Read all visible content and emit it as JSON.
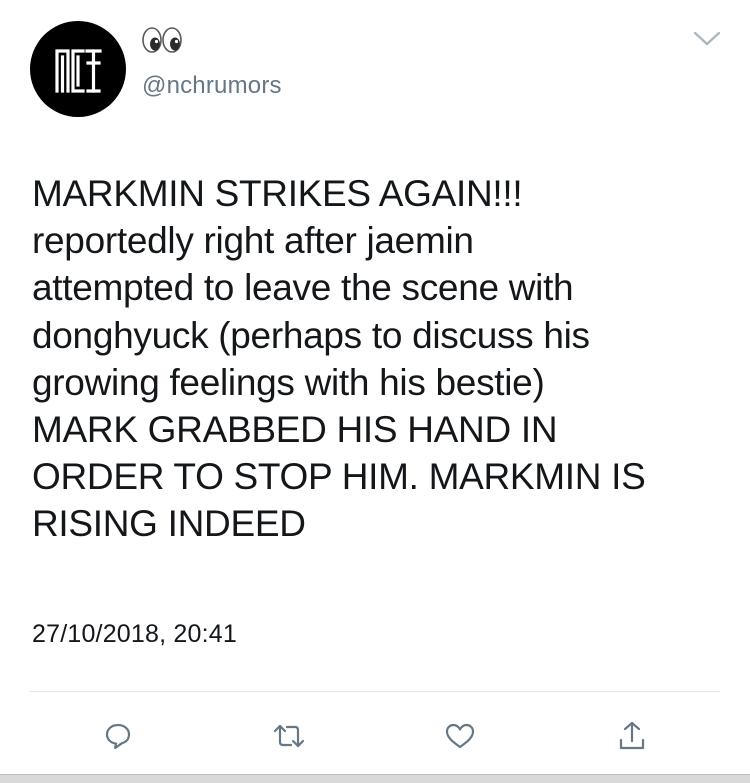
{
  "tweet": {
    "display_name_icon": "eyes-emoji-icon",
    "handle": "@nchrumors",
    "avatar_logo": "NCT",
    "body": "MARKMIN STRIKES AGAIN!!!\nreportedly right after jaemin\nattempted to leave the scene with\ndonghyuck (perhaps to discuss his\ngrowing feelings with his bestie)\nMARK GRABBED HIS HAND IN\nORDER TO STOP HIM. MARKMIN IS\nRISING INDEED",
    "timestamp": "27/10/2018, 20:41"
  },
  "actions": [
    {
      "name": "reply-icon"
    },
    {
      "name": "retweet-icon"
    },
    {
      "name": "like-icon"
    },
    {
      "name": "share-icon"
    }
  ],
  "colors": {
    "text": "#14171a",
    "secondary": "#657786",
    "icon": "#657786",
    "divider": "#e1e8ed"
  }
}
